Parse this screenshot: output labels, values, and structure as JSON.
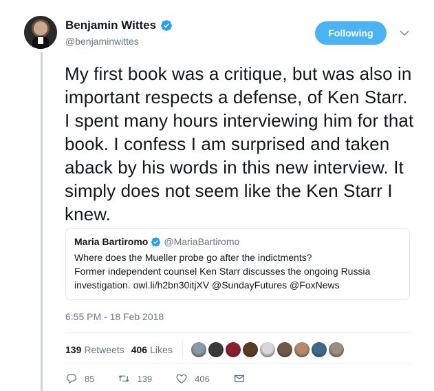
{
  "author": {
    "display_name": "Benjamin Wittes",
    "handle": "@benjaminwittes",
    "verified": true
  },
  "follow_button": {
    "label": "Following"
  },
  "tweet": {
    "text": "My first book was a critique, but was also in important respects a defense, of Ken Starr. I spent many hours interviewing him for that book. I confess I am surprised and taken aback by his words in this new interview. It simply does not seem like the Ken Starr I knew."
  },
  "quoted_tweet": {
    "display_name": "Maria Bartiromo",
    "handle": "@MariaBartiromo",
    "verified": true,
    "text": "Where does the Mueller probe go after the indictments?\nFormer independent counsel Ken Starr discusses the ongoing Russia investigation. owl.li/h2bn30itjXV @SundayFutures @FoxNews"
  },
  "timestamp": "6:55 PM - 18 Feb 2018",
  "stats": {
    "retweets_count": "139",
    "retweets_label": "Retweets",
    "likes_count": "406",
    "likes_label": "Likes"
  },
  "likers_avatar_colors": [
    "#8a9aa6",
    "#3a3a3a",
    "#8b1e2e",
    "#5a3b24",
    "#d8d8d8",
    "#6e5a46",
    "#b58a6a",
    "#3d6b8c",
    "#9a8e7e"
  ],
  "actions": {
    "replies": "85",
    "retweets": "139",
    "likes": "406"
  },
  "colors": {
    "accent": "#1da1f2",
    "follow_bg": "#4ab3f4",
    "secondary_text": "#657786"
  }
}
